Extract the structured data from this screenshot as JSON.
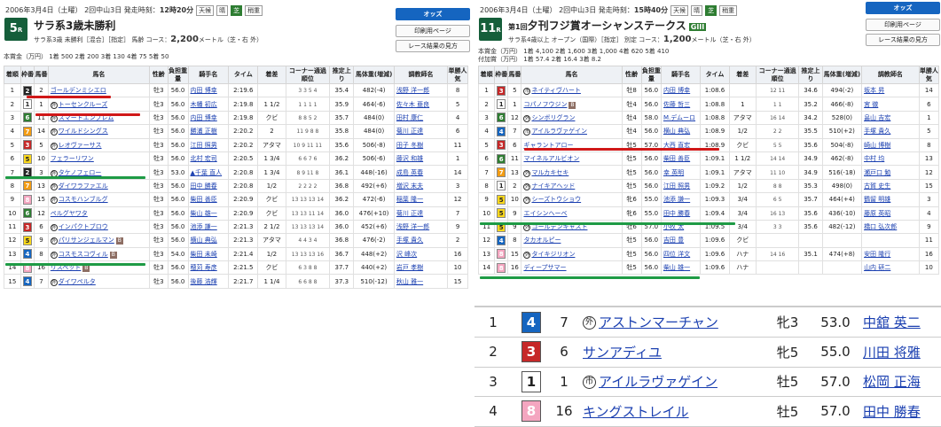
{
  "colors": {
    "f1": "#ffffff",
    "f2": "#222222",
    "f3": "#c62828",
    "f4": "#1565c0",
    "f5": "#f9d71c",
    "f6": "#2e7d32",
    "f7": "#f39c12",
    "f8": "#f4a6c0"
  },
  "left": {
    "date": "2006年3月4日（土曜） 2回中山3日 発走時刻：",
    "time": "12時20分",
    "tags": [
      "天候",
      "晴",
      "芝",
      "稍重"
    ],
    "race_no": "5",
    "race_suffix": "R",
    "title": "サラ系3歳未勝利",
    "sub": "サラ系3歳 未勝利［混合］［指定］ 馬齢 コース：",
    "dist": "2,200",
    "sub2": "メートル（芝・右 外）",
    "prize": "本賞金（万円） 1着 500 2着 200 3着 130 4着 75 5着 50",
    "buttons": [
      "オッズ",
      "印刷用ページ",
      "レース結果の見方"
    ],
    "headers": [
      "着順",
      "枠番",
      "馬番",
      "馬名",
      "性齢",
      "負担重量",
      "騎手名",
      "タイム",
      "着差",
      "コーナー通過順位",
      "推定上り",
      "馬体重(増減)",
      "調教師名",
      "単勝人気"
    ],
    "rows": [
      [
        "1",
        "2",
        "2",
        "ゴールデンミシエロ",
        "",
        "牡3",
        "56.0",
        "内田 博幸",
        "2:19.6",
        "",
        "3 3 5 4",
        "35.4",
        "482(-4)",
        "浅野 洋一郎",
        "8"
      ],
      [
        "2",
        "1",
        "1",
        "トーセンクルーズ",
        "外",
        "牡3",
        "56.0",
        "木幡 初広",
        "2:19.8",
        "1 1/2",
        "1 1 1 1",
        "35.9",
        "464(-6)",
        "佐々木 亜良",
        "5"
      ],
      [
        "3",
        "6",
        "11",
        "スマートエンブレム",
        "外",
        "牡3",
        "56.0",
        "内田 博幸",
        "2:19.8",
        "クビ",
        "8 8 5 2",
        "35.7",
        "484(0)",
        "田村 康仁",
        "4"
      ],
      [
        "4",
        "7",
        "14",
        "ワイルドシングス",
        "外",
        "牡3",
        "56.0",
        "勝浦 正樹",
        "2:20.2",
        "2",
        "11 9 8 8",
        "35.8",
        "484(0)",
        "菊川 正達",
        "6"
      ],
      [
        "5",
        "3",
        "5",
        "レオヴァーサス",
        "外",
        "牡3",
        "56.0",
        "江田 照男",
        "2:20.2",
        "アタマ",
        "10 9 11 11",
        "35.6",
        "506(-8)",
        "田子 冬樹",
        "11"
      ],
      [
        "6",
        "5",
        "10",
        "フェラーリワン",
        "",
        "牡3",
        "56.0",
        "北村 宏司",
        "2:20.5",
        "1 3/4",
        "6 6 7 6",
        "36.2",
        "506(-6)",
        "藤沢 和雄",
        "1"
      ],
      [
        "7",
        "2",
        "3",
        "タケノフェロー",
        "外",
        "牡3",
        "53.0",
        "▲千葉 直人",
        "2:20.8",
        "1 3/4",
        "8 9 11 8",
        "36.1",
        "448(-16)",
        "成島 英春",
        "14"
      ],
      [
        "8",
        "7",
        "13",
        "ダイワラファエル",
        "外",
        "牡3",
        "56.0",
        "田中 勝春",
        "2:20.8",
        "1/2",
        "2 2 2 2",
        "36.8",
        "492(+6)",
        "増沢 末夫",
        "3"
      ],
      [
        "9",
        "8",
        "15",
        "コスモハンブルグ",
        "外",
        "牡3",
        "56.0",
        "柴田 善臣",
        "2:20.9",
        "クビ",
        "13 13 13 14",
        "36.2",
        "472(-6)",
        "稲葉 隆一",
        "12"
      ],
      [
        "10",
        "6",
        "12",
        "ペルグヤワタ",
        "",
        "牡3",
        "56.0",
        "柴山 雄一",
        "2:20.9",
        "クビ",
        "13 13 11 14",
        "36.0",
        "476(+10)",
        "菊川 正達",
        "7"
      ],
      [
        "11",
        "3",
        "6",
        "インパクトブロウ",
        "外",
        "牡3",
        "56.0",
        "池添 謙一",
        "2:21.3",
        "2 1/2",
        "13 13 13 14",
        "36.0",
        "452(+6)",
        "浅野 洋一郎",
        "9"
      ],
      [
        "12",
        "5",
        "9",
        "パリサンジェルマン",
        "外",
        "牡3",
        "56.0",
        "横山 典弘",
        "2:21.3",
        "アタマ",
        "4 4 3 4",
        "36.8",
        "476(-2)",
        "手塚 貴久",
        "2"
      ],
      [
        "13",
        "4",
        "8",
        "コスモスコヴィル",
        "外",
        "牡3",
        "54.0",
        "柴田 未崎",
        "2:21.4",
        "1/2",
        "13 13 13 16",
        "36.7",
        "448(+2)",
        "沢 峰次",
        "16"
      ],
      [
        "14",
        "8",
        "16",
        "リスペット",
        "",
        "牡3",
        "56.0",
        "穂苅 寿彦",
        "2:21.5",
        "クビ",
        "6 3 8 8",
        "37.7",
        "440(+2)",
        "岩戸 孝樹",
        "10"
      ],
      [
        "15",
        "4",
        "7",
        "ダイワペルタ",
        "外",
        "牡3",
        "56.0",
        "後藤 浩輝",
        "2:21.7",
        "1 1/4",
        "6 6 8 8",
        "37.3",
        "510(-12)",
        "秋山 雅一",
        "15"
      ]
    ]
  },
  "right": {
    "date": "2006年3月4日（土曜） 2回中山3日 発走時刻：",
    "time": "15時40分",
    "tags": [
      "天候",
      "晴",
      "芝",
      "稍重"
    ],
    "race_no": "11",
    "race_suffix": "R",
    "title_pre": "第1回",
    "title": "夕刊フジ賞オーシャンステークス",
    "grade": "GIII",
    "sub": "サラ系4歳以上 オープン（国際）［指定］ 別定 コース：",
    "dist": "1,200",
    "sub2": "メートル（芝・右 外）",
    "prize1": "本賞金（万円） 1着 4,100 2着 1,600 3着 1,000 4着 620 5着 410",
    "prize2": "付加賞（万円） 1着 57.4 2着 16.4 3着 8.2",
    "buttons": [
      "オッズ",
      "印刷用ページ",
      "レース結果の見方"
    ],
    "headers": [
      "着順",
      "枠番",
      "馬番",
      "馬名",
      "性齢",
      "負担重量",
      "騎手名",
      "タイム",
      "着差",
      "コーナー通過順位",
      "推定上り",
      "馬体重(増減)",
      "調教師名",
      "単勝人気"
    ],
    "rows": [
      [
        "1",
        "3",
        "5",
        "ネイティヴハート",
        "市",
        "牡8",
        "56.0",
        "内田 博幸",
        "1:08.6",
        "",
        "12 11",
        "34.6",
        "494(-2)",
        "坂本 昇",
        "14"
      ],
      [
        "2",
        "1",
        "1",
        "コパノフウジン",
        "",
        "牡4",
        "56.0",
        "佐藤 哲三",
        "1:08.8",
        "1",
        "1 1",
        "35.2",
        "466(-8)",
        "宮 徹",
        "6"
      ],
      [
        "3",
        "6",
        "12",
        "シンボリグラン",
        "外",
        "牡4",
        "58.0",
        "M.デムーロ",
        "1:08.8",
        "アタマ",
        "16 14",
        "34.2",
        "528(0)",
        "畠山 吉宏",
        "1"
      ],
      [
        "4",
        "4",
        "7",
        "アイルラヴァゲイン",
        "市",
        "牡4",
        "56.0",
        "横山 典弘",
        "1:08.9",
        "1/2",
        "2 2",
        "35.5",
        "510(+2)",
        "手塚 貴久",
        "5"
      ],
      [
        "5",
        "3",
        "6",
        "ギャラントアロー",
        "",
        "牡5",
        "57.0",
        "大西 直宏",
        "1:08.9",
        "クビ",
        "5 5",
        "35.6",
        "504(-8)",
        "崎山 博樹",
        "8"
      ],
      [
        "6",
        "6",
        "11",
        "マイネルアルビオン",
        "",
        "牡5",
        "56.0",
        "柴田 善臣",
        "1:09.1",
        "1 1/2",
        "14 14",
        "34.9",
        "462(-8)",
        "中村 均",
        "13"
      ],
      [
        "7",
        "7",
        "13",
        "マルカキセキ",
        "外",
        "牡5",
        "56.0",
        "幸 英明",
        "1:09.1",
        "アタマ",
        "11 10",
        "34.9",
        "516(-18)",
        "瀬戸口 勉",
        "12"
      ],
      [
        "8",
        "1",
        "2",
        "ナイキアヘッド",
        "外",
        "牡5",
        "56.0",
        "江田 照男",
        "1:09.2",
        "1/2",
        "8 8",
        "35.3",
        "498(0)",
        "古賀 史生",
        "15"
      ],
      [
        "9",
        "5",
        "10",
        "シーズトウショウ",
        "外",
        "牝6",
        "55.0",
        "池添 謙一",
        "1:09.3",
        "3/4",
        "6 5",
        "35.7",
        "464(+4)",
        "鶴留 明雄",
        "3"
      ],
      [
        "10",
        "5",
        "9",
        "エイシンヘーベ",
        "",
        "牝6",
        "55.0",
        "田中 勝春",
        "1:09.4",
        "3/4",
        "16 13",
        "35.6",
        "436(-10)",
        "藤原 英昭",
        "4"
      ],
      [
        "11",
        "5",
        "9",
        "ゴールデンキャスト",
        "外",
        "牡6",
        "57.0",
        "小牧 太",
        "1:09.5",
        "3/4",
        "3 3",
        "35.6",
        "482(-12)",
        "橋口 弘次郎",
        "9"
      ],
      [
        "12",
        "4",
        "8",
        "タカオルピー",
        "",
        "牡5",
        "56.0",
        "吉田 豊",
        "1:09.6",
        "クビ",
        "",
        "",
        "",
        "",
        "11"
      ],
      [
        "13",
        "8",
        "15",
        "タイキジリオン",
        "外",
        "牡5",
        "56.0",
        "四位 洋文",
        "1:09.6",
        "ハナ",
        "14 16",
        "35.1",
        "474(+8)",
        "安田 隆行",
        "16"
      ],
      [
        "14",
        "8",
        "16",
        "ディープサマー",
        "",
        "牡5",
        "56.0",
        "柴山 雄一",
        "1:09.6",
        "ハナ",
        "",
        "",
        "",
        "山内 研二",
        "10"
      ]
    ]
  },
  "zoom": {
    "rows": [
      [
        "1",
        "4",
        "7",
        "外",
        "アストンマーチャン",
        "牝3",
        "53.0",
        "中舘 英二"
      ],
      [
        "2",
        "3",
        "6",
        "",
        "サンアディユ",
        "牝5",
        "55.0",
        "川田 将雅"
      ],
      [
        "3",
        "1",
        "1",
        "市",
        "アイルラヴァゲイン",
        "牡5",
        "57.0",
        "松岡 正海"
      ],
      [
        "4",
        "8",
        "16",
        "",
        "キングストレイル",
        "牡5",
        "57.0",
        "田中 勝春"
      ]
    ]
  }
}
